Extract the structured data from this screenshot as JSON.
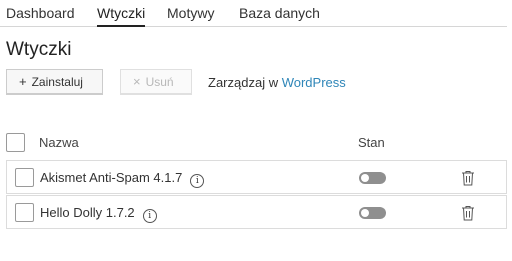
{
  "tabs": [
    {
      "label": "Dashboard",
      "active": false
    },
    {
      "label": "Wtyczki",
      "active": true
    },
    {
      "label": "Motywy",
      "active": false
    },
    {
      "label": "Baza danych",
      "active": false
    }
  ],
  "page_title": "Wtyczki",
  "toolbar": {
    "install_label": "Zainstaluj",
    "install_icon": "plus-icon",
    "remove_label": "Usuń",
    "remove_icon": "close-icon",
    "manage_text": "Zarządzaj w",
    "manage_link": "WordPress"
  },
  "table": {
    "columns": [
      "Nazwa",
      "Stan"
    ],
    "rows": [
      {
        "name": "Akismet Anti-Spam 4.1.7",
        "enabled": false
      },
      {
        "name": "Hello Dolly 1.7.2",
        "enabled": false
      }
    ]
  },
  "colors": {
    "link": "#2f86b8",
    "toggle_off": "#8f8f8f",
    "tab_active_underline": "#222222"
  }
}
